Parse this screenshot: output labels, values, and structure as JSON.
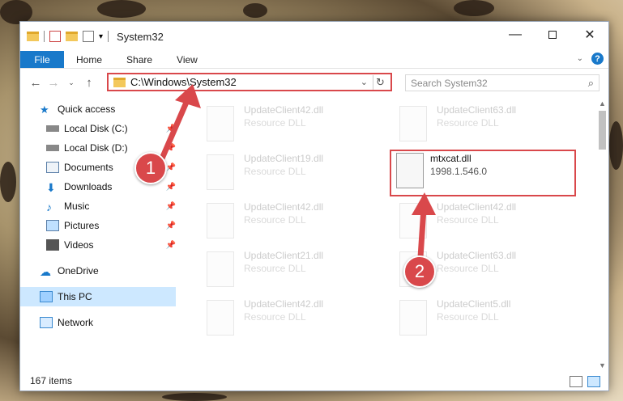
{
  "window": {
    "title": "System32",
    "controls": [
      "minimize-icon",
      "maximize-icon",
      "close-icon"
    ]
  },
  "ribbon": {
    "tabs": [
      "File",
      "Home",
      "Share",
      "View"
    ],
    "help": "?"
  },
  "navigation": {
    "address": "C:\\Windows\\System32",
    "search_placeholder": "Search System32"
  },
  "sidebar": {
    "items": [
      {
        "label": "Quick access",
        "icon": "star-icon"
      },
      {
        "label": "Local Disk (C:)",
        "icon": "drive-icon"
      },
      {
        "label": "Local Disk (D:)",
        "icon": "drive-icon"
      },
      {
        "label": "Documents",
        "icon": "documents-icon"
      },
      {
        "label": "Downloads",
        "icon": "download-icon"
      },
      {
        "label": "Music",
        "icon": "music-icon"
      },
      {
        "label": "Pictures",
        "icon": "pictures-icon"
      },
      {
        "label": "Videos",
        "icon": "videos-icon"
      },
      {
        "label": "OneDrive",
        "icon": "cloud-icon"
      },
      {
        "label": "This PC",
        "icon": "computer-icon"
      },
      {
        "label": "Network",
        "icon": "network-icon"
      }
    ]
  },
  "files": {
    "faded": [
      {
        "name": "UpdateClient42.dll",
        "type": "Resource DLL"
      },
      {
        "name": "UpdateClient63.dll",
        "type": "Resource DLL"
      },
      {
        "name": "UpdateClient19.dll",
        "type": "Resource DLL"
      },
      {
        "name": "UpdateClient42.dll",
        "type": "Resource DLL"
      },
      {
        "name": "UpdateClient42.dll",
        "type": "Resource DLL"
      },
      {
        "name": "UpdateClient21.dll",
        "type": "Resource DLL"
      },
      {
        "name": "UpdateClient63.dll",
        "type": "Resource DLL"
      },
      {
        "name": "UpdateClient42.dll",
        "type": "Resource DLL"
      },
      {
        "name": "UpdateClient5.dll",
        "type": "Resource DLL"
      }
    ],
    "highlighted": {
      "name": "mtxcat.dll",
      "version": "1998.1.546.0"
    }
  },
  "status": {
    "count": "167 items"
  },
  "annotations": {
    "step1": "1",
    "step2": "2",
    "color": "#d9484b"
  }
}
